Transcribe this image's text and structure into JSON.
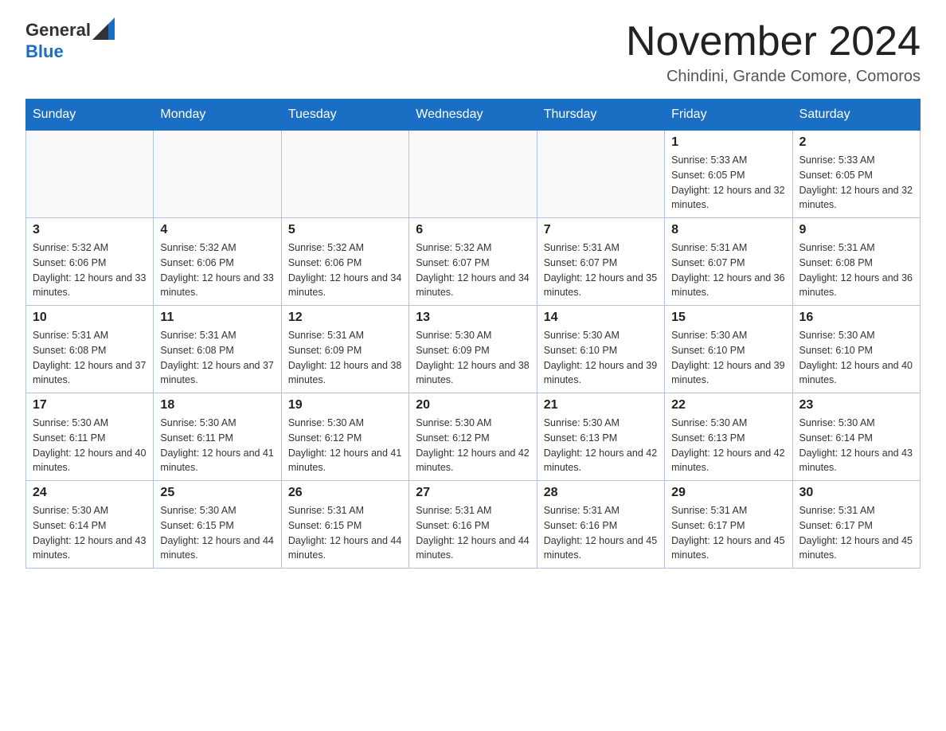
{
  "header": {
    "logo_general": "General",
    "logo_blue": "Blue",
    "month_title": "November 2024",
    "location": "Chindini, Grande Comore, Comoros"
  },
  "weekdays": [
    "Sunday",
    "Monday",
    "Tuesday",
    "Wednesday",
    "Thursday",
    "Friday",
    "Saturday"
  ],
  "weeks": [
    [
      {
        "day": "",
        "sunrise": "",
        "sunset": "",
        "daylight": ""
      },
      {
        "day": "",
        "sunrise": "",
        "sunset": "",
        "daylight": ""
      },
      {
        "day": "",
        "sunrise": "",
        "sunset": "",
        "daylight": ""
      },
      {
        "day": "",
        "sunrise": "",
        "sunset": "",
        "daylight": ""
      },
      {
        "day": "",
        "sunrise": "",
        "sunset": "",
        "daylight": ""
      },
      {
        "day": "1",
        "sunrise": "Sunrise: 5:33 AM",
        "sunset": "Sunset: 6:05 PM",
        "daylight": "Daylight: 12 hours and 32 minutes."
      },
      {
        "day": "2",
        "sunrise": "Sunrise: 5:33 AM",
        "sunset": "Sunset: 6:05 PM",
        "daylight": "Daylight: 12 hours and 32 minutes."
      }
    ],
    [
      {
        "day": "3",
        "sunrise": "Sunrise: 5:32 AM",
        "sunset": "Sunset: 6:06 PM",
        "daylight": "Daylight: 12 hours and 33 minutes."
      },
      {
        "day": "4",
        "sunrise": "Sunrise: 5:32 AM",
        "sunset": "Sunset: 6:06 PM",
        "daylight": "Daylight: 12 hours and 33 minutes."
      },
      {
        "day": "5",
        "sunrise": "Sunrise: 5:32 AM",
        "sunset": "Sunset: 6:06 PM",
        "daylight": "Daylight: 12 hours and 34 minutes."
      },
      {
        "day": "6",
        "sunrise": "Sunrise: 5:32 AM",
        "sunset": "Sunset: 6:07 PM",
        "daylight": "Daylight: 12 hours and 34 minutes."
      },
      {
        "day": "7",
        "sunrise": "Sunrise: 5:31 AM",
        "sunset": "Sunset: 6:07 PM",
        "daylight": "Daylight: 12 hours and 35 minutes."
      },
      {
        "day": "8",
        "sunrise": "Sunrise: 5:31 AM",
        "sunset": "Sunset: 6:07 PM",
        "daylight": "Daylight: 12 hours and 36 minutes."
      },
      {
        "day": "9",
        "sunrise": "Sunrise: 5:31 AM",
        "sunset": "Sunset: 6:08 PM",
        "daylight": "Daylight: 12 hours and 36 minutes."
      }
    ],
    [
      {
        "day": "10",
        "sunrise": "Sunrise: 5:31 AM",
        "sunset": "Sunset: 6:08 PM",
        "daylight": "Daylight: 12 hours and 37 minutes."
      },
      {
        "day": "11",
        "sunrise": "Sunrise: 5:31 AM",
        "sunset": "Sunset: 6:08 PM",
        "daylight": "Daylight: 12 hours and 37 minutes."
      },
      {
        "day": "12",
        "sunrise": "Sunrise: 5:31 AM",
        "sunset": "Sunset: 6:09 PM",
        "daylight": "Daylight: 12 hours and 38 minutes."
      },
      {
        "day": "13",
        "sunrise": "Sunrise: 5:30 AM",
        "sunset": "Sunset: 6:09 PM",
        "daylight": "Daylight: 12 hours and 38 minutes."
      },
      {
        "day": "14",
        "sunrise": "Sunrise: 5:30 AM",
        "sunset": "Sunset: 6:10 PM",
        "daylight": "Daylight: 12 hours and 39 minutes."
      },
      {
        "day": "15",
        "sunrise": "Sunrise: 5:30 AM",
        "sunset": "Sunset: 6:10 PM",
        "daylight": "Daylight: 12 hours and 39 minutes."
      },
      {
        "day": "16",
        "sunrise": "Sunrise: 5:30 AM",
        "sunset": "Sunset: 6:10 PM",
        "daylight": "Daylight: 12 hours and 40 minutes."
      }
    ],
    [
      {
        "day": "17",
        "sunrise": "Sunrise: 5:30 AM",
        "sunset": "Sunset: 6:11 PM",
        "daylight": "Daylight: 12 hours and 40 minutes."
      },
      {
        "day": "18",
        "sunrise": "Sunrise: 5:30 AM",
        "sunset": "Sunset: 6:11 PM",
        "daylight": "Daylight: 12 hours and 41 minutes."
      },
      {
        "day": "19",
        "sunrise": "Sunrise: 5:30 AM",
        "sunset": "Sunset: 6:12 PM",
        "daylight": "Daylight: 12 hours and 41 minutes."
      },
      {
        "day": "20",
        "sunrise": "Sunrise: 5:30 AM",
        "sunset": "Sunset: 6:12 PM",
        "daylight": "Daylight: 12 hours and 42 minutes."
      },
      {
        "day": "21",
        "sunrise": "Sunrise: 5:30 AM",
        "sunset": "Sunset: 6:13 PM",
        "daylight": "Daylight: 12 hours and 42 minutes."
      },
      {
        "day": "22",
        "sunrise": "Sunrise: 5:30 AM",
        "sunset": "Sunset: 6:13 PM",
        "daylight": "Daylight: 12 hours and 42 minutes."
      },
      {
        "day": "23",
        "sunrise": "Sunrise: 5:30 AM",
        "sunset": "Sunset: 6:14 PM",
        "daylight": "Daylight: 12 hours and 43 minutes."
      }
    ],
    [
      {
        "day": "24",
        "sunrise": "Sunrise: 5:30 AM",
        "sunset": "Sunset: 6:14 PM",
        "daylight": "Daylight: 12 hours and 43 minutes."
      },
      {
        "day": "25",
        "sunrise": "Sunrise: 5:30 AM",
        "sunset": "Sunset: 6:15 PM",
        "daylight": "Daylight: 12 hours and 44 minutes."
      },
      {
        "day": "26",
        "sunrise": "Sunrise: 5:31 AM",
        "sunset": "Sunset: 6:15 PM",
        "daylight": "Daylight: 12 hours and 44 minutes."
      },
      {
        "day": "27",
        "sunrise": "Sunrise: 5:31 AM",
        "sunset": "Sunset: 6:16 PM",
        "daylight": "Daylight: 12 hours and 44 minutes."
      },
      {
        "day": "28",
        "sunrise": "Sunrise: 5:31 AM",
        "sunset": "Sunset: 6:16 PM",
        "daylight": "Daylight: 12 hours and 45 minutes."
      },
      {
        "day": "29",
        "sunrise": "Sunrise: 5:31 AM",
        "sunset": "Sunset: 6:17 PM",
        "daylight": "Daylight: 12 hours and 45 minutes."
      },
      {
        "day": "30",
        "sunrise": "Sunrise: 5:31 AM",
        "sunset": "Sunset: 6:17 PM",
        "daylight": "Daylight: 12 hours and 45 minutes."
      }
    ]
  ]
}
